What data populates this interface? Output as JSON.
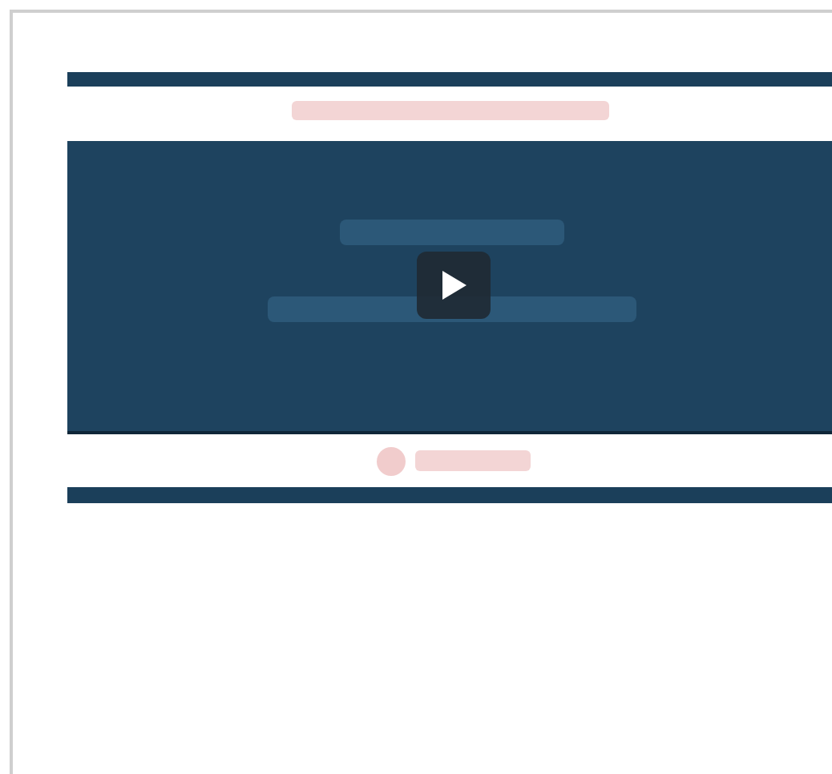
{
  "video": {
    "kind": "picture",
    "play_button": {
      "kind": "play"
    }
  }
}
